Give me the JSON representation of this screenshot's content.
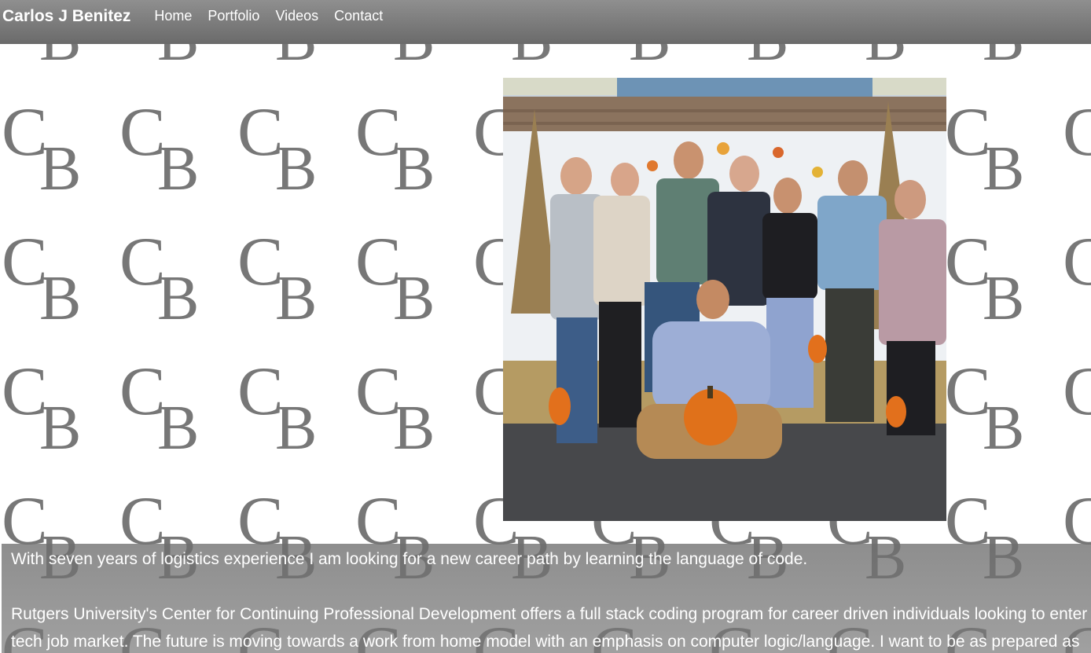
{
  "nav": {
    "brand": "Carlos J Benitez",
    "links": [
      "Home",
      "Portfolio",
      "Videos",
      "Contact"
    ]
  },
  "hero": {
    "alt": "Family photo with pumpkins"
  },
  "bio": {
    "paragraph1": "With seven years of logistics experience I am looking for a new career path by learning the language of code.",
    "paragraph2": "Rutgers University's Center for Continuing Professional Development offers a full stack coding program for career driven individuals looking to enter the tech job market. The future is moving towards a work from home model with an emphasis on computer logic/language. I want to be as prepared as possible."
  },
  "colors": {
    "nav_bg": "#7c7c7c",
    "monogram": "#777777",
    "panel_bg": "#808080",
    "text": "#ffffff"
  }
}
